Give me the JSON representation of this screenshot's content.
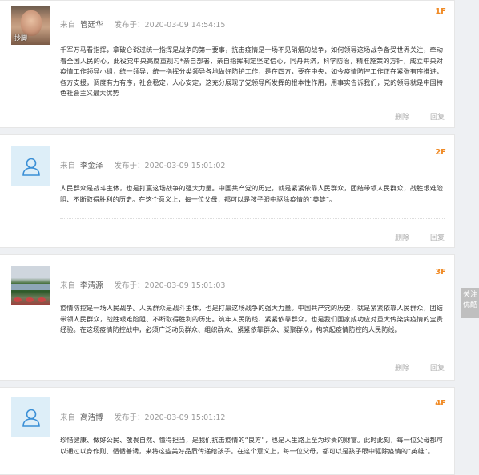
{
  "labels": {
    "from": "来自",
    "posted": "发布于：",
    "delete": "删除",
    "reply": "回复"
  },
  "comments": [
    {
      "floor": "1F",
      "user": "管廷华",
      "time": "2020-03-09 14:54:15",
      "avatar_caption": "抄脚",
      "content": "千军万马看指挥，拿破仑说过统一指挥是战争的第一要事，抗击疫情是一场不见硝烟的战争，如何领导这场战争备受世界关注，牵动着全国人民的心，此役党中央高度重视习*亲自部署，亲自指挥制定坚定信心，同舟共济，科学防治，精准施策的方针，成立中央对疫情工作领导小组，统一领导，统一指挥分类领导各地做好防护工作，是在四方，要在中央，如今疫情防控工作正在紧张有序推进，各方支援，调度有力有序，社会稳定，人心安定，这充分展现了党领导所发挥的根本性作用，用事实告诉我们，党的领导就是中国特色社会主义最大优势"
    },
    {
      "floor": "2F",
      "user": "李金泽",
      "time": "2020-03-09 15:01:02",
      "content": "人民群众是战斗主体，也是打赢这场战争的强大力量。中国共产党的历史，就是紧紧依靠人民群众，团结带领人民群众，战胜艰难险阻、不断取得胜利的历史。在这个意义上，每一位父母，都可以是孩子眼中驱除疫情的“英雄”。"
    },
    {
      "floor": "3F",
      "user": "李清源",
      "time": "2020-03-09 15:01:03",
      "content": "疫情防控是一场人民战争。人民群众是战斗主体，也是打赢这场战争的强大力量。中国共产党的历史，就是紧紧依靠人民群众，团结带领人民群众，战胜艰难险阻、不断取得胜利的历史。筑牢人民防线、紧紧依靠群众，也是我们国家成功应对重大传染病疫情的宝贵经验。在这场疫情防控战中，必须广泛动员群众、组织群众、紧紧依靠群众、凝聚群众，构筑起疫情防控的人民防线。"
    },
    {
      "floor": "4F",
      "user": "高浩博",
      "time": "2020-03-09 15:01:12",
      "content": "珍惜健康、做好公民、敬畏自然、懂得担当，是我们抗击疫情的“良方”，也是人生路上至为珍贵的财富。此时此刻，每一位父母都可以通过以身作则、循循善诱，来将这些美好品质传递给孩子。在这个意义上，每一位父母，都可以是孩子眼中驱除疫情的“英雄”。"
    }
  ],
  "side_tab": {
    "line1": "关注",
    "line2": "优酷"
  }
}
